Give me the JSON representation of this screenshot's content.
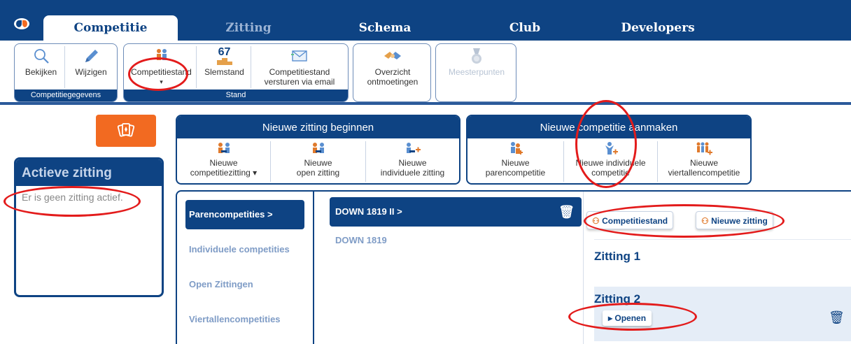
{
  "nav": {
    "tabs": [
      {
        "label": "Competitie"
      },
      {
        "label": "Zitting"
      },
      {
        "label": "Schema"
      },
      {
        "label": "Club"
      },
      {
        "label": "Developers"
      }
    ]
  },
  "ribbon": {
    "groups": [
      {
        "label": "Competitiegegevens",
        "buttons": [
          {
            "label": "Bekijken",
            "icon": "magnifier-icon"
          },
          {
            "label": "Wijzigen",
            "icon": "pencil-icon"
          }
        ]
      },
      {
        "label": "Stand",
        "buttons": [
          {
            "label": "Competitiestand",
            "icon": "players-icon",
            "caret": "▾"
          },
          {
            "label": "Slemstand",
            "icon": "podium-icon",
            "badge": "67"
          },
          {
            "label": "Competitiestand versturen via email",
            "line1": "Competitiestand",
            "line2": "versturen via email",
            "icon": "envelope-icon"
          }
        ]
      },
      {
        "label": "",
        "buttons": [
          {
            "label": "Overzicht ontmoetingen",
            "line1": "Overzicht",
            "line2": "ontmoetingen",
            "icon": "handshake-icon"
          }
        ]
      },
      {
        "label": "",
        "buttons": [
          {
            "label": "Meesterpunten",
            "icon": "medal-icon",
            "disabled": true
          }
        ]
      }
    ]
  },
  "active_session": {
    "title": "Actieve zitting",
    "message": "Er is geen zitting actief."
  },
  "new_session": {
    "title": "Nieuwe zitting beginnen",
    "buttons": [
      {
        "line1": "Nieuwe",
        "line2": "competitiezitting",
        "caret": "▾",
        "icon": "group-icon"
      },
      {
        "line1": "Nieuwe",
        "line2": "open zitting",
        "icon": "group-icon"
      },
      {
        "line1": "Nieuwe",
        "line2": "individuele zitting",
        "icon": "table-plus-icon"
      }
    ]
  },
  "new_competition": {
    "title": "Nieuwe competitie aanmaken",
    "buttons": [
      {
        "line1": "Nieuwe",
        "line2": "parencompetitie",
        "icon": "pair-plus-icon"
      },
      {
        "line1": "Nieuwe individuele",
        "line2": "competitie",
        "icon": "person-plus-icon"
      },
      {
        "line1": "Nieuwe",
        "line2": "viertallencompetitie",
        "icon": "team-plus-icon"
      }
    ]
  },
  "competitions": {
    "nav": [
      {
        "label": "Parencompetities >",
        "selected": true
      },
      {
        "label": "Individuele competities"
      },
      {
        "label": "Open Zittingen"
      },
      {
        "label": "Viertallencompetities"
      }
    ],
    "list": [
      {
        "label": "DOWN 1819 II >",
        "selected": true
      },
      {
        "label": "DOWN 1819"
      }
    ],
    "actions": {
      "standing": "Competitiestand",
      "new_session": "Nieuwe zitting"
    },
    "sessions": [
      {
        "label": "Zitting 1"
      },
      {
        "label": "Zitting 2",
        "open_label": "Openen"
      }
    ]
  },
  "colors": {
    "brand_blue": "#0e4383",
    "accent_orange": "#f26a21",
    "annotation_red": "#e31b1b"
  }
}
